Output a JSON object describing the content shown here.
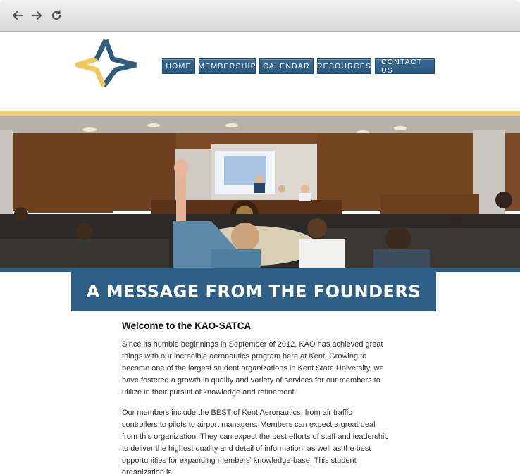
{
  "browser": {
    "back_icon": "arrow-left-icon",
    "forward_icon": "arrow-right-icon",
    "reload_icon": "reload-icon"
  },
  "site": {
    "logo_icon": "four-point-star-logo",
    "colors": {
      "navy": "#2d5f87",
      "gold": "#f1d07a"
    },
    "nav": [
      "HOME",
      "MEMBERSHIP",
      "CALENDAR",
      "RESOURCES",
      "CONTACT US"
    ]
  },
  "hero": {
    "image": "photo of a student meeting in a lecture hall with a raised hand"
  },
  "banner": {
    "title": "A MESSAGE FROM THE FOUNDERS"
  },
  "content": {
    "heading": "Welcome to the KAO-SATCA",
    "paragraphs": [
      "Since its humble beginnings in September of 2012, KAO has achieved great things with our incredible aeronautics program here at Kent. Growing to become one of the largest student organizations in Kent State University, we have fostered a growth in quality and variety of services for our members to utilize in their pursuit of knowledge and refinement.",
      "Our members include the BEST of Kent Aeronautics, from air traffic controllers to pilots to airport managers. Members can expect a great deal from this organization. They can expect the best efforts of staff and leadership to deliver the highest quality and detail of information, as well as the best opportunities for expanding members' knowledge-base. This student organization is"
    ]
  }
}
